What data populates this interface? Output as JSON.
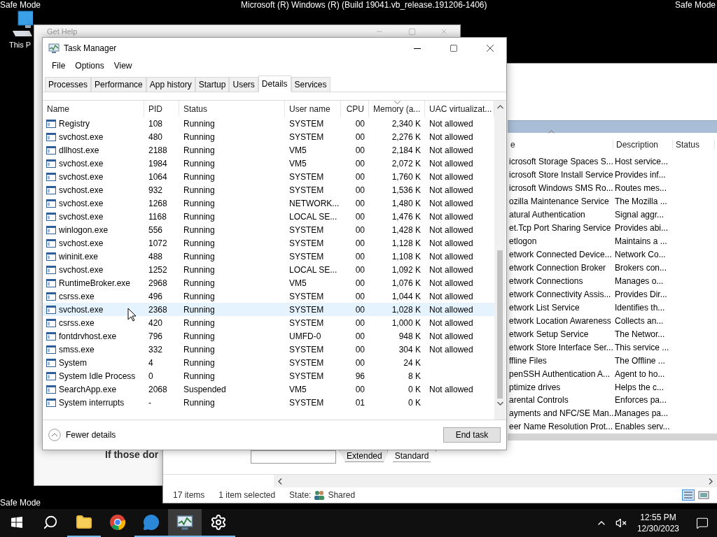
{
  "desktop": {
    "top_left_label": "Safe Mode",
    "build_title": "Microsoft (R) Windows (R) (Build 19041.vb_release.191206-1406)",
    "top_right_label": "Safe Mode",
    "bottom_left_label": "Safe Mode",
    "icons": [
      {
        "label": "This P"
      }
    ]
  },
  "get_help": {
    "title": "Get Help",
    "body_text": "If those dor"
  },
  "services_window": {
    "columns": [
      "e",
      "Description",
      "Status"
    ],
    "rows": [
      {
        "name": "icrosoft Storage Spaces S...",
        "description": "Host service..."
      },
      {
        "name": "icrosoft Store Install Service",
        "description": "Provides inf..."
      },
      {
        "name": "icrosoft Windows SMS Ro...",
        "description": "Routes mes..."
      },
      {
        "name": "ozilla Maintenance Service",
        "description": "The Mozilla ..."
      },
      {
        "name": "atural Authentication",
        "description": "Signal aggr..."
      },
      {
        "name": "et.Tcp Port Sharing Service",
        "description": "Provides abi..."
      },
      {
        "name": "etlogon",
        "description": "Maintains a ..."
      },
      {
        "name": "etwork Connected Device...",
        "description": "Network Co..."
      },
      {
        "name": "etwork Connection Broker",
        "description": "Brokers con..."
      },
      {
        "name": "etwork Connections",
        "description": "Manages o..."
      },
      {
        "name": "etwork Connectivity Assis...",
        "description": "Provides Dir..."
      },
      {
        "name": "etwork List Service",
        "description": "Identifies th..."
      },
      {
        "name": "etwork Location Awareness",
        "description": "Collects an..."
      },
      {
        "name": "etwork Setup Service",
        "description": "The Networ..."
      },
      {
        "name": "etwork Store Interface Ser...",
        "description": "This service ..."
      },
      {
        "name": "ffline Files",
        "description": "The Offline ..."
      },
      {
        "name": "penSSH Authentication A...",
        "description": "Agent to ho..."
      },
      {
        "name": "ptimize drives",
        "description": "Helps the c..."
      },
      {
        "name": "arental Controls",
        "description": "Enforces pa..."
      },
      {
        "name": "ayments and NFC/SE Man...",
        "description": "Manages pa..."
      },
      {
        "name": "eer Name Resolution Prot...",
        "description": "Enables serv..."
      }
    ],
    "tabs": [
      {
        "label": "Extended",
        "selected": false
      },
      {
        "label": "Standard",
        "selected": true
      }
    ],
    "status_bar": {
      "items": "17 items",
      "selection": "1 item selected",
      "state_label": "State:",
      "state_value": "Shared"
    }
  },
  "task_manager": {
    "title": "Task Manager",
    "menu": [
      "File",
      "Options",
      "View"
    ],
    "tabs": [
      {
        "label": "Processes",
        "selected": false
      },
      {
        "label": "Performance",
        "selected": false
      },
      {
        "label": "App history",
        "selected": false
      },
      {
        "label": "Startup",
        "selected": false
      },
      {
        "label": "Users",
        "selected": false
      },
      {
        "label": "Details",
        "selected": true
      },
      {
        "label": "Services",
        "selected": false
      }
    ],
    "columns": [
      "Name",
      "PID",
      "Status",
      "User name",
      "CPU",
      "Memory (a...",
      "UAC virtualizat..."
    ],
    "rows": [
      {
        "name": "Registry",
        "pid": "108",
        "status": "Running",
        "user": "SYSTEM",
        "cpu": "00",
        "memory": "2,340 K",
        "uac": "Not allowed",
        "selected": false
      },
      {
        "name": "svchost.exe",
        "pid": "480",
        "status": "Running",
        "user": "SYSTEM",
        "cpu": "00",
        "memory": "2,276 K",
        "uac": "Not allowed",
        "selected": false
      },
      {
        "name": "dllhost.exe",
        "pid": "2188",
        "status": "Running",
        "user": "VM5",
        "cpu": "00",
        "memory": "2,184 K",
        "uac": "Not allowed",
        "selected": false
      },
      {
        "name": "svchost.exe",
        "pid": "1984",
        "status": "Running",
        "user": "VM5",
        "cpu": "00",
        "memory": "2,072 K",
        "uac": "Not allowed",
        "selected": false
      },
      {
        "name": "svchost.exe",
        "pid": "1064",
        "status": "Running",
        "user": "SYSTEM",
        "cpu": "00",
        "memory": "1,760 K",
        "uac": "Not allowed",
        "selected": false
      },
      {
        "name": "svchost.exe",
        "pid": "932",
        "status": "Running",
        "user": "SYSTEM",
        "cpu": "00",
        "memory": "1,536 K",
        "uac": "Not allowed",
        "selected": false
      },
      {
        "name": "svchost.exe",
        "pid": "1268",
        "status": "Running",
        "user": "NETWORK...",
        "cpu": "00",
        "memory": "1,480 K",
        "uac": "Not allowed",
        "selected": false
      },
      {
        "name": "svchost.exe",
        "pid": "1168",
        "status": "Running",
        "user": "LOCAL SE...",
        "cpu": "00",
        "memory": "1,476 K",
        "uac": "Not allowed",
        "selected": false
      },
      {
        "name": "winlogon.exe",
        "pid": "556",
        "status": "Running",
        "user": "SYSTEM",
        "cpu": "00",
        "memory": "1,428 K",
        "uac": "Not allowed",
        "selected": false
      },
      {
        "name": "svchost.exe",
        "pid": "1072",
        "status": "Running",
        "user": "SYSTEM",
        "cpu": "00",
        "memory": "1,128 K",
        "uac": "Not allowed",
        "selected": false
      },
      {
        "name": "wininit.exe",
        "pid": "488",
        "status": "Running",
        "user": "SYSTEM",
        "cpu": "00",
        "memory": "1,108 K",
        "uac": "Not allowed",
        "selected": false
      },
      {
        "name": "svchost.exe",
        "pid": "1252",
        "status": "Running",
        "user": "LOCAL SE...",
        "cpu": "00",
        "memory": "1,092 K",
        "uac": "Not allowed",
        "selected": false
      },
      {
        "name": "RuntimeBroker.exe",
        "pid": "2968",
        "status": "Running",
        "user": "VM5",
        "cpu": "00",
        "memory": "1,076 K",
        "uac": "Not allowed",
        "selected": false
      },
      {
        "name": "csrss.exe",
        "pid": "496",
        "status": "Running",
        "user": "SYSTEM",
        "cpu": "00",
        "memory": "1,044 K",
        "uac": "Not allowed",
        "selected": false
      },
      {
        "name": "svchost.exe",
        "pid": "2368",
        "status": "Running",
        "user": "SYSTEM",
        "cpu": "00",
        "memory": "1,028 K",
        "uac": "Not allowed",
        "selected": true
      },
      {
        "name": "csrss.exe",
        "pid": "420",
        "status": "Running",
        "user": "SYSTEM",
        "cpu": "00",
        "memory": "1,000 K",
        "uac": "Not allowed",
        "selected": false
      },
      {
        "name": "fontdrvhost.exe",
        "pid": "796",
        "status": "Running",
        "user": "UMFD-0",
        "cpu": "00",
        "memory": "948 K",
        "uac": "Not allowed",
        "selected": false
      },
      {
        "name": "smss.exe",
        "pid": "332",
        "status": "Running",
        "user": "SYSTEM",
        "cpu": "00",
        "memory": "304 K",
        "uac": "Not allowed",
        "selected": false
      },
      {
        "name": "System",
        "pid": "4",
        "status": "Running",
        "user": "SYSTEM",
        "cpu": "00",
        "memory": "24 K",
        "selected": false
      },
      {
        "name": "System Idle Process",
        "pid": "0",
        "status": "Running",
        "user": "SYSTEM",
        "cpu": "96",
        "memory": "8 K",
        "selected": false
      },
      {
        "name": "SearchApp.exe",
        "pid": "2068",
        "status": "Suspended",
        "user": "VM5",
        "cpu": "00",
        "memory": "0 K",
        "uac": "Not allowed",
        "selected": false
      },
      {
        "name": "System interrupts",
        "pid": "-",
        "status": "Running",
        "user": "SYSTEM",
        "cpu": "01",
        "memory": "0 K",
        "selected": false
      }
    ],
    "footer": {
      "toggle": "Fewer details",
      "end_task": "End task"
    }
  },
  "taskbar": {
    "apps": [
      {
        "kind": "start",
        "running": false,
        "active": false
      },
      {
        "kind": "search",
        "running": false,
        "active": false
      },
      {
        "kind": "folder",
        "running": true,
        "active": false
      },
      {
        "kind": "browser",
        "running": false,
        "active": false
      },
      {
        "kind": "help",
        "running": true,
        "active": false
      },
      {
        "kind": "taskmanager",
        "running": true,
        "active": true
      },
      {
        "kind": "settings",
        "running": true,
        "active": false
      }
    ],
    "clock": {
      "time": "12:55 PM",
      "date": "12/30/2023"
    }
  }
}
